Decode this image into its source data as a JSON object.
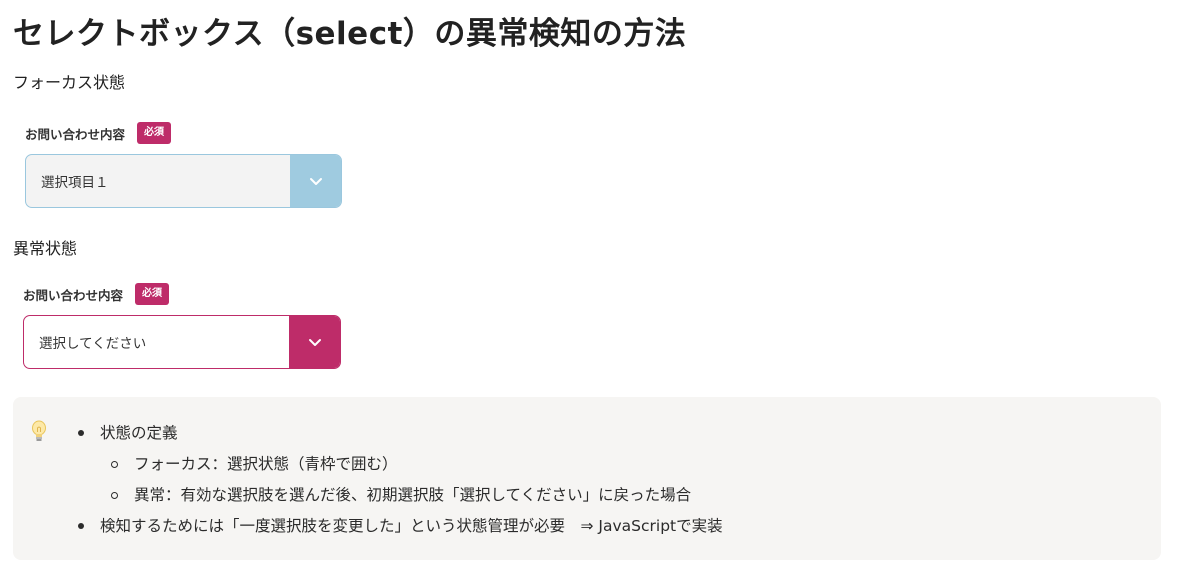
{
  "title": "セレクトボックス（select）の異常検知の方法",
  "focus_section": {
    "heading": "フォーカス状態",
    "field_label": "お問い合わせ内容",
    "badge": "必須",
    "selected_value": "選択項目１",
    "border_color": "#9ac7de",
    "arrow_bg_color": "#9fcbe0"
  },
  "error_section": {
    "heading": "異常状態",
    "field_label": "お問い合わせ内容",
    "badge": "必須",
    "selected_value": "選択してください",
    "border_color": "#be2c69",
    "arrow_bg_color": "#be2c69"
  },
  "callout": {
    "icon": "lightbulb-icon",
    "items": [
      {
        "text": "状態の定義"
      },
      {
        "text": "フォーカス：選択状態（青枠で囲む）"
      },
      {
        "text": "異常：有効な選択肢を選んだ後、初期選択肢「選択してください」に戻った場合"
      },
      {
        "text": "検知するためには「一度選択肢を変更した」という状態管理が必要　⇒ JavaScriptで実装"
      }
    ]
  },
  "colors": {
    "badge": "#be2c69",
    "callout_bg": "#f6f5f3"
  }
}
